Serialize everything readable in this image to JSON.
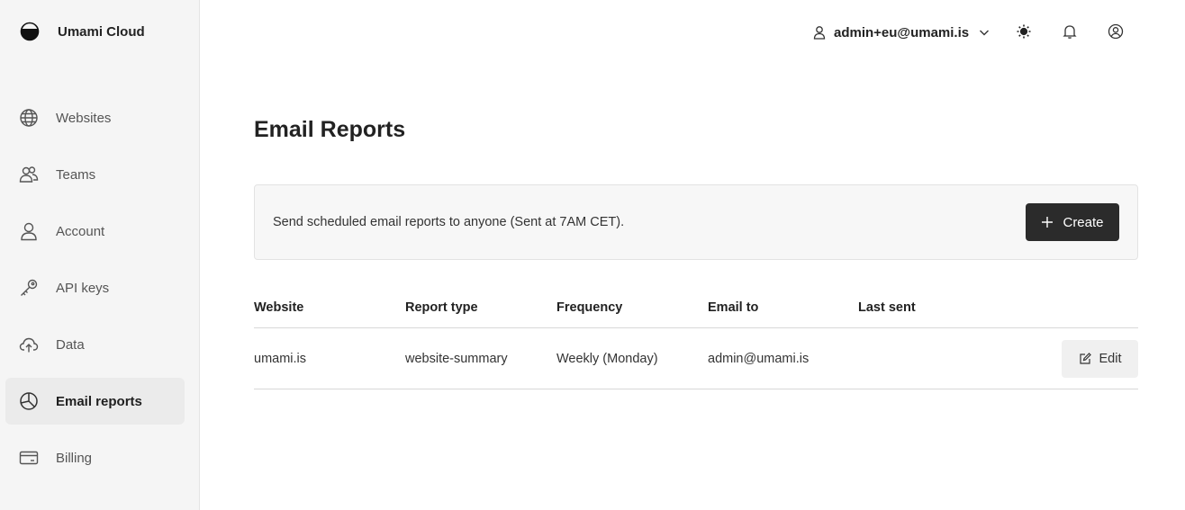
{
  "app": {
    "name": "Umami Cloud",
    "logo_icon": "umami-logo-icon"
  },
  "sidebar": {
    "items": [
      {
        "label": "Websites",
        "icon": "globe-icon",
        "active": false
      },
      {
        "label": "Teams",
        "icon": "users-icon",
        "active": false
      },
      {
        "label": "Account",
        "icon": "user-icon",
        "active": false
      },
      {
        "label": "API keys",
        "icon": "key-icon",
        "active": false
      },
      {
        "label": "Data",
        "icon": "cloud-upload-icon",
        "active": false
      },
      {
        "label": "Email reports",
        "icon": "pie-chart-icon",
        "active": true
      },
      {
        "label": "Billing",
        "icon": "credit-card-icon",
        "active": false
      }
    ]
  },
  "header": {
    "user_email": "admin+eu@umami.is",
    "icons": [
      "user-icon",
      "chevron-down-icon",
      "sun-icon",
      "bell-icon",
      "profile-circle-icon"
    ]
  },
  "page": {
    "title": "Email Reports"
  },
  "banner": {
    "description": "Send scheduled email reports to anyone (Sent at 7AM CET).",
    "create_label": "Create"
  },
  "table": {
    "columns": [
      "Website",
      "Report type",
      "Frequency",
      "Email to",
      "Last sent"
    ],
    "rows": [
      {
        "website": "umami.is",
        "report_type": "website-summary",
        "frequency": "Weekly (Monday)",
        "email_to": "admin@umami.is",
        "last_sent": "",
        "edit_label": "Edit"
      }
    ]
  },
  "colors": {
    "primary_button": "#2b2b2b",
    "sidebar_bg": "#f5f5f5",
    "active_nav_bg": "#ebebeb"
  }
}
